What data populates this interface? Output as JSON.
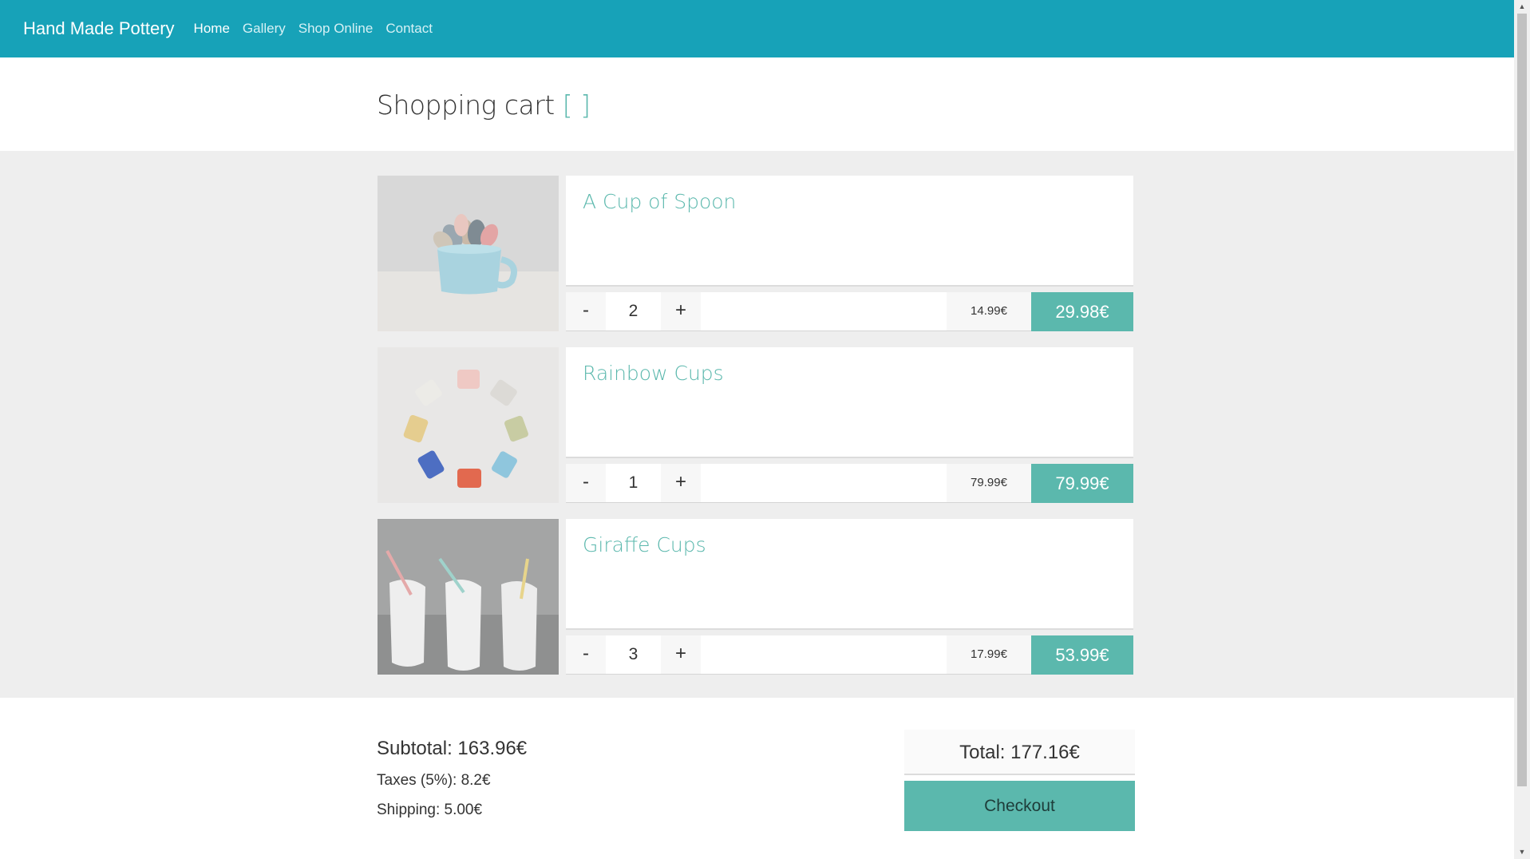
{
  "nav": {
    "brand": "Hand Made Pottery",
    "links": [
      "Home",
      "Gallery",
      "Shop Online",
      "Contact"
    ]
  },
  "page": {
    "title": "Shopping cart",
    "title_bracket": "[ ]"
  },
  "items": [
    {
      "name": "A Cup of Spoon",
      "qty_minus": "-",
      "qty": "2",
      "qty_plus": "+",
      "unit_price": "14.99€",
      "line_total": "29.98€",
      "image": "cup-with-spoons"
    },
    {
      "name": "Rainbow Cups",
      "qty_minus": "-",
      "qty": "1",
      "qty_plus": "+",
      "unit_price": "79.99€",
      "line_total": "79.99€",
      "image": "rainbow-cups-circle"
    },
    {
      "name": "Giraffe Cups",
      "qty_minus": "-",
      "qty": "3",
      "qty_plus": "+",
      "unit_price": "17.99€",
      "line_total": "53.99€",
      "image": "giraffe-cups-with-straws"
    }
  ],
  "summary": {
    "subtotal": "Subtotal: 163.96€",
    "taxes": "Taxes (5%): 8.2€",
    "shipping": "Shipping: 5.00€",
    "total": "Total: 177.16€",
    "checkout": "Checkout"
  },
  "colors": {
    "navbar": "#17a2b8",
    "accent": "#5bb8ad",
    "cart_background": "#eeeeee"
  }
}
